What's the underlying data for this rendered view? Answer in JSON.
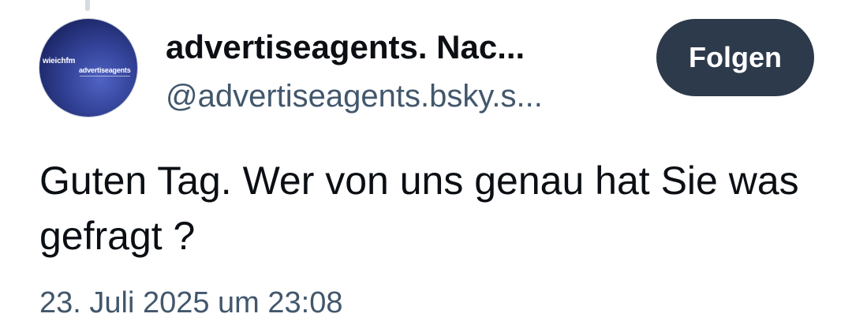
{
  "post": {
    "author": {
      "display_name": "advertiseagents. Nac...",
      "handle": "@advertiseagents.bsky.s...",
      "avatar": {
        "logo_primary": "wieichfm",
        "logo_secondary": "advertiseagents"
      }
    },
    "follow_label": "Folgen",
    "text": "Guten Tag. Wer von uns genau hat Sie was gefragt ?",
    "timestamp": "23. Juli 2025 um 23:08"
  },
  "colors": {
    "follow_button_bg": "#2d3a4b",
    "secondary_text": "#42576c",
    "primary_text": "#0b0f14"
  }
}
